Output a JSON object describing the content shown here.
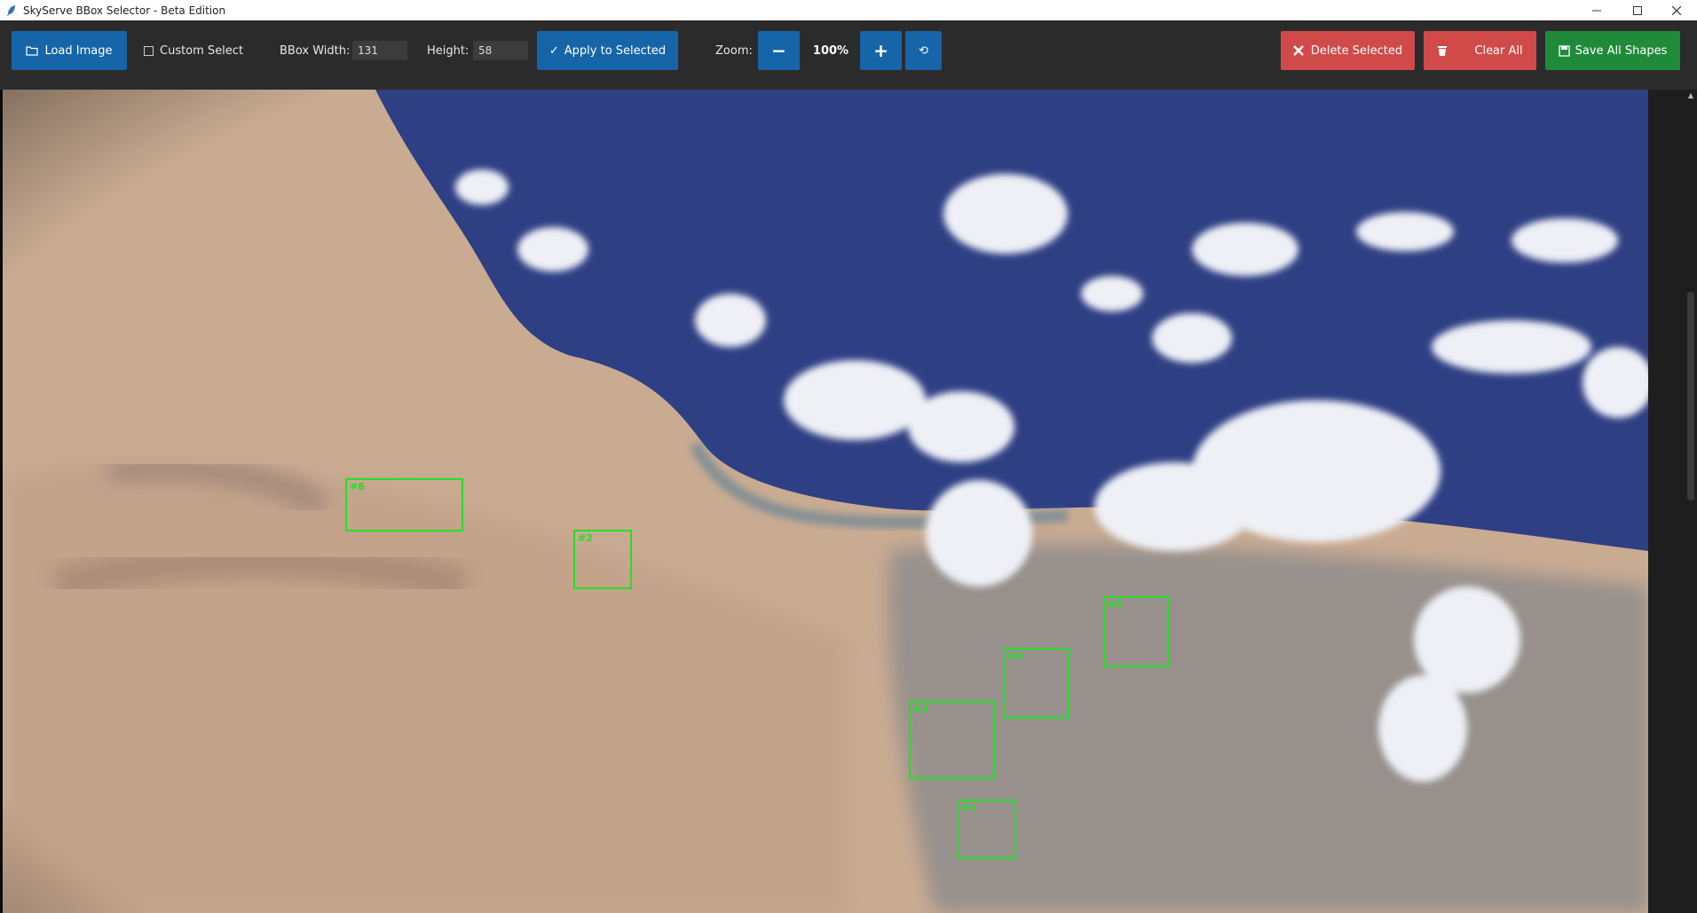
{
  "window": {
    "title": "SkyServe BBox Selector - Beta Edition",
    "controls": [
      "—",
      "☐",
      "✕"
    ]
  },
  "toolbar": {
    "load_image": "Load Image",
    "custom_select": "Custom Select",
    "bbox_width_label": "BBox Width:",
    "bbox_width_value": "131",
    "height_label": "Height:",
    "height_value": "58",
    "apply_selected": "Apply to Selected",
    "zoom_label": "Zoom:",
    "zoom_out": "−",
    "zoom_value": "100%",
    "zoom_in": "+",
    "zoom_reset": "⟲",
    "delete_selected": "Delete Selected",
    "clear_all": "Clear All",
    "save_all": "Save All Shapes"
  },
  "colors": {
    "blue_button": "#1565a8",
    "red_button": "#d04a4a",
    "green_button": "#1f8b3a",
    "bbox": "#22e022"
  },
  "canvas": {
    "image_description": "satellite image of coastline with desert, sea and clouds",
    "bboxes": [
      {
        "id": "#6"
      },
      {
        "id": "#2"
      },
      {
        "id": "#5"
      },
      {
        "id": "#4"
      },
      {
        "id": "#3"
      },
      {
        "id": "#1"
      }
    ]
  },
  "scrollbar": {
    "up_arrow": "▲"
  }
}
